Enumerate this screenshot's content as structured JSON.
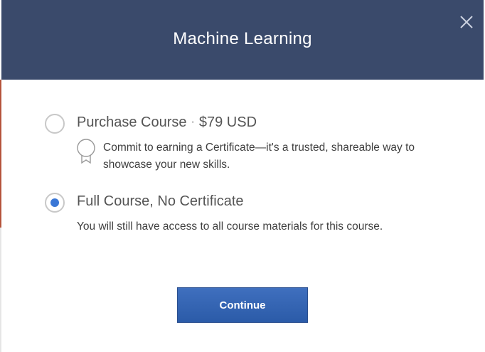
{
  "modal": {
    "title": "Machine Learning",
    "close_icon": "close-icon"
  },
  "options": [
    {
      "id": "purchase",
      "title": "Purchase Course",
      "separator": "·",
      "price": "$79 USD",
      "checked": false,
      "icon": "certificate-ribbon-icon",
      "description": "Commit to earning a Certificate—it's a trusted, shareable way to showcase your new skills."
    },
    {
      "id": "audit",
      "title": "Full Course, No Certificate",
      "checked": true,
      "description": "You will still have access to all course materials for this course."
    }
  ],
  "actions": {
    "continue_label": "Continue"
  },
  "colors": {
    "header_bg": "#3a4a6b",
    "radio_selected": "#3a77d6",
    "button_bg": "#2f62b2"
  }
}
